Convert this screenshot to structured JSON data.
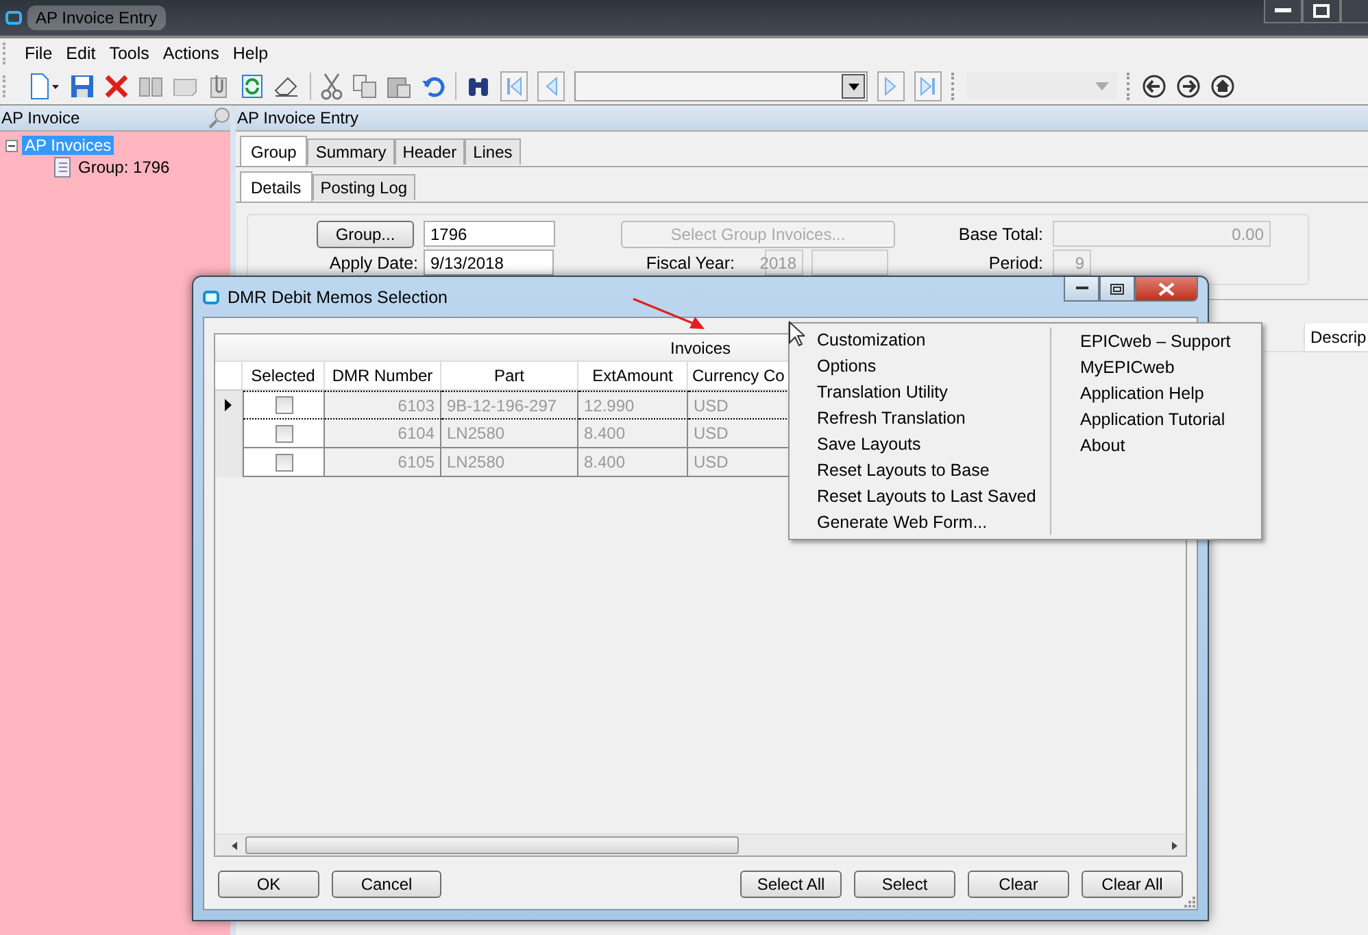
{
  "window": {
    "title": "AP Invoice Entry"
  },
  "menu": [
    "File",
    "Edit",
    "Tools",
    "Actions",
    "Help"
  ],
  "left_panel": {
    "title": "AP Invoice",
    "tree": [
      {
        "label": "AP Invoices",
        "selected": true,
        "expanded": true,
        "children": [
          {
            "label": "Group: 1796",
            "selected": false
          }
        ]
      }
    ]
  },
  "main_panel": {
    "title": "AP Invoice Entry",
    "tabs": [
      {
        "label": "Group",
        "selected": true
      },
      {
        "label": "Summary",
        "selected": false
      },
      {
        "label": "Header",
        "selected": false
      },
      {
        "label": "Lines",
        "selected": false
      }
    ],
    "subtabs": [
      {
        "label": "Details",
        "selected": true
      },
      {
        "label": "Posting Log",
        "selected": false
      }
    ],
    "form": {
      "group_button": "Group...",
      "group": "1796",
      "select_group_invoices": {
        "label": "Select Group Invoices...",
        "disabled": true
      },
      "base_total_label": "Base Total:",
      "base_total": "0.00",
      "apply_date_label": "Apply Date:",
      "apply_date": "9/13/2018",
      "fiscal_year_label": "Fiscal Year:",
      "fiscal_year": "2018",
      "period_label": "Period:",
      "period": "9"
    },
    "grid_columns": [
      "Descrip"
    ]
  },
  "dialog": {
    "title": "DMR Debit Memos Selection",
    "band": "Invoices",
    "columns": [
      "Selected",
      "DMR Number",
      "Part",
      "ExtAmount",
      "Currency Co"
    ],
    "rows": [
      {
        "current": true,
        "checked": false,
        "dmr_number": "6103",
        "part": "9B-12-196-297",
        "ext_amount": "12.990",
        "currency": "USD"
      },
      {
        "current": false,
        "checked": false,
        "dmr_number": "6104",
        "part": "LN2580",
        "ext_amount": "8.400",
        "currency": "USD"
      },
      {
        "current": false,
        "checked": false,
        "dmr_number": "6105",
        "part": "LN2580",
        "ext_amount": "8.400",
        "currency": "USD"
      }
    ],
    "buttons_left": [
      "OK",
      "Cancel"
    ],
    "buttons_right": [
      "Select All",
      "Select",
      "Clear",
      "Clear All"
    ]
  },
  "context_menu": {
    "columns": [
      [
        "Customization",
        "Options",
        "Translation Utility",
        "Refresh Translation",
        "Save Layouts",
        "Reset Layouts to Base",
        "Reset Layouts to Last Saved",
        "Generate Web Form..."
      ],
      [
        "EPICweb – Support",
        "MyEPICweb",
        "Application Help",
        "Application Tutorial",
        "About"
      ]
    ]
  }
}
